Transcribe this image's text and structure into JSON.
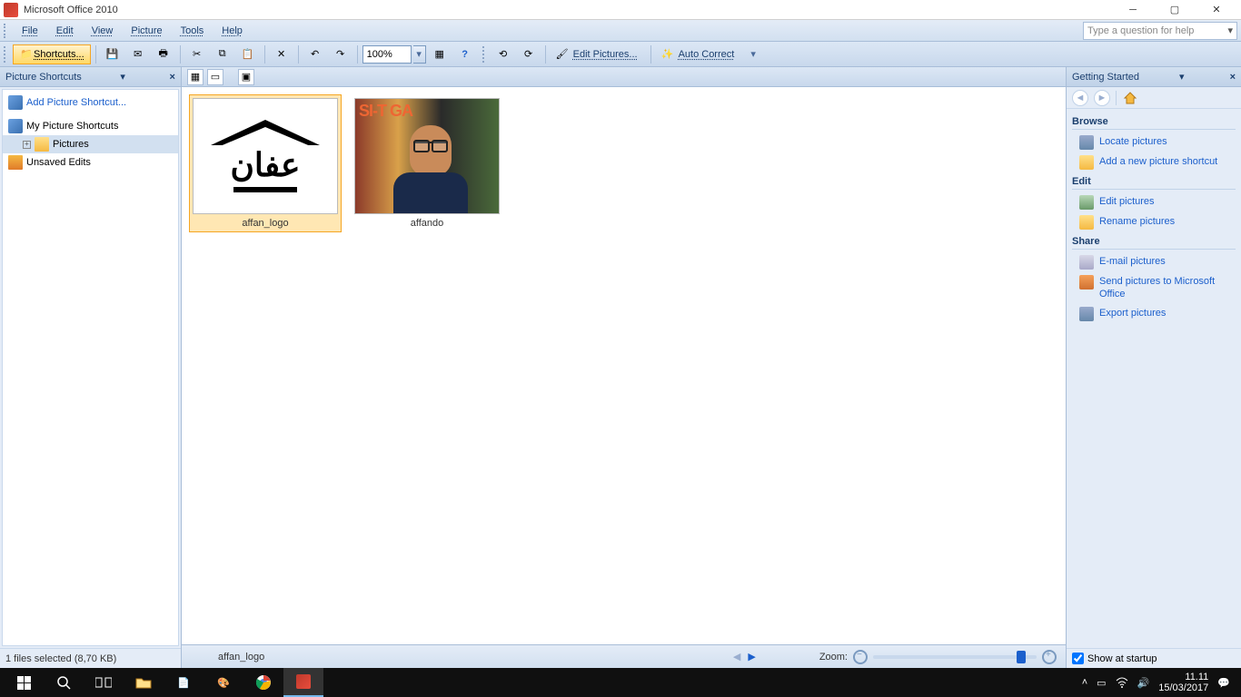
{
  "titlebar": {
    "title": "Microsoft Office 2010"
  },
  "menubar": {
    "items": [
      "File",
      "Edit",
      "View",
      "Picture",
      "Tools",
      "Help"
    ],
    "help_placeholder": "Type a question for help"
  },
  "toolbar": {
    "shortcuts_label": "Shortcuts...",
    "zoom_value": "100%",
    "edit_pictures_label": "Edit Pictures...",
    "auto_correct_label": "Auto Correct"
  },
  "left_panel": {
    "title": "Picture Shortcuts",
    "add_shortcut": "Add Picture Shortcut...",
    "tree": {
      "root": "My Picture Shortcuts",
      "pictures": "Pictures",
      "unsaved": "Unsaved Edits"
    },
    "status": "1 files selected (8,70 KB)"
  },
  "thumbnails": [
    {
      "label": "affan_logo",
      "selected": true,
      "kind": "logo"
    },
    {
      "label": "affando",
      "selected": false,
      "kind": "photo"
    }
  ],
  "photo_overlay": "SI-T   GA",
  "arabic_text": "عفان",
  "center_status": {
    "filename": "affan_logo",
    "zoom_label": "Zoom:"
  },
  "right_panel": {
    "title": "Getting Started",
    "sections": {
      "browse": {
        "title": "Browse",
        "links": [
          "Locate pictures",
          "Add a new picture shortcut"
        ]
      },
      "edit": {
        "title": "Edit",
        "links": [
          "Edit pictures",
          "Rename pictures"
        ]
      },
      "share": {
        "title": "Share",
        "links": [
          "E-mail pictures",
          "Send pictures to Microsoft Office",
          "Export pictures"
        ]
      }
    },
    "startup_label": "Show at startup"
  },
  "taskbar": {
    "time": "11.11",
    "date": "15/03/2017"
  }
}
